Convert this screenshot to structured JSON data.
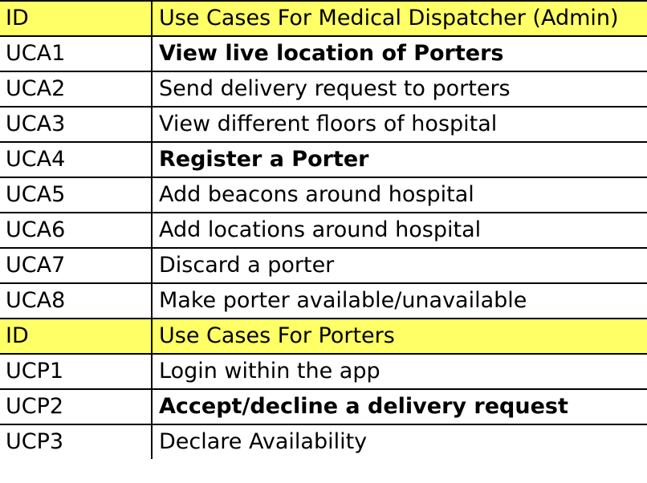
{
  "table": {
    "header_color": "#ffff66",
    "rows": [
      {
        "type": "header",
        "id": "ID",
        "desc": "Use Cases For Medical Dispatcher (Admin)",
        "bold": false
      },
      {
        "type": "row",
        "id": "UCA1",
        "desc": "View live location of Porters",
        "bold": true
      },
      {
        "type": "row",
        "id": "UCA2",
        "desc": "Send delivery request to porters",
        "bold": false
      },
      {
        "type": "row",
        "id": "UCA3",
        "desc": "View different floors of hospital",
        "bold": false
      },
      {
        "type": "row",
        "id": "UCA4",
        "desc": "Register a Porter",
        "bold": true
      },
      {
        "type": "row",
        "id": "UCA5",
        "desc": "Add beacons around hospital",
        "bold": false
      },
      {
        "type": "row",
        "id": "UCA6",
        "desc": "Add locations around hospital",
        "bold": false
      },
      {
        "type": "row",
        "id": "UCA7",
        "desc": "Discard a porter",
        "bold": false
      },
      {
        "type": "row",
        "id": "UCA8",
        "desc": "Make porter available/unavailable",
        "bold": false
      },
      {
        "type": "header",
        "id": "ID",
        "desc": "Use Cases For Porters",
        "bold": false
      },
      {
        "type": "row",
        "id": "UCP1",
        "desc": "Login within the app",
        "bold": false
      },
      {
        "type": "row",
        "id": "UCP2",
        "desc": "Accept/decline a delivery request",
        "bold": true
      },
      {
        "type": "row",
        "id": "UCP3",
        "desc": "Declare Availability",
        "bold": false
      }
    ]
  }
}
